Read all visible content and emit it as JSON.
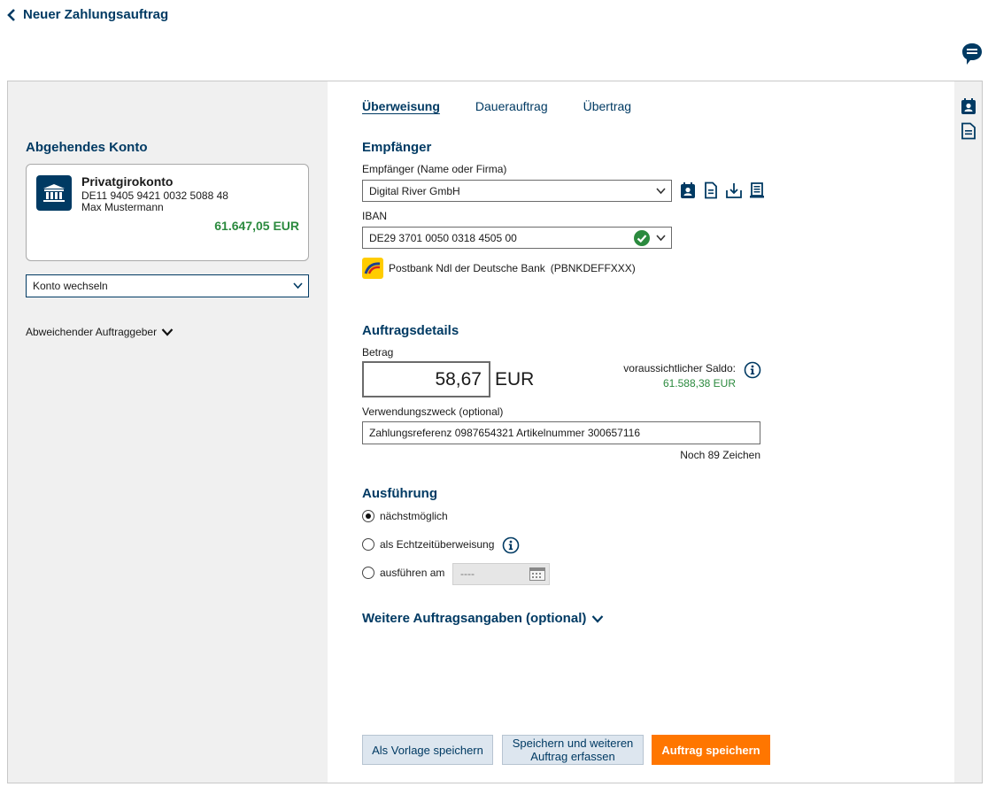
{
  "header": {
    "back_label": "Neuer Zahlungsauftrag"
  },
  "left": {
    "section_title": "Abgehendes Konto",
    "account": {
      "name": "Privatgirokonto",
      "iban": "DE11 9405 9421 0032 5088 48",
      "holder": "Max Mustermann",
      "balance": "61.647,05 EUR"
    },
    "switch_account_label": "Konto wechseln",
    "other_sender_label": "Abweichender Auftraggeber"
  },
  "tabs": [
    {
      "label": "Überweisung",
      "active": true
    },
    {
      "label": "Dauerauftrag",
      "active": false
    },
    {
      "label": "Übertrag",
      "active": false
    }
  ],
  "recipient": {
    "section_title": "Empfänger",
    "name_label": "Empfänger (Name oder Firma)",
    "name_value": "Digital River GmbH",
    "iban_label": "IBAN",
    "iban_value": "DE29 3701 0050 0318 4505 00",
    "bank_name": "Postbank Ndl der Deutsche Bank",
    "bic": "(PBNKDEFFXXX)"
  },
  "details": {
    "section_title": "Auftragsdetails",
    "amount_label": "Betrag",
    "amount_value": "58,67",
    "currency": "EUR",
    "saldo_label": "voraussichtlicher Saldo:",
    "saldo_value": "61.588,38 EUR",
    "purpose_label": "Verwendungszweck (optional)",
    "purpose_value": "Zahlungsreferenz 0987654321 Artikelnummer 300657116",
    "char_count": "Noch 89 Zeichen"
  },
  "execution": {
    "section_title": "Ausführung",
    "options": [
      {
        "label": "nächstmöglich",
        "checked": true
      },
      {
        "label": "als Echtzeitüberweisung",
        "checked": false
      },
      {
        "label": "ausführen am",
        "checked": false
      }
    ],
    "date_placeholder": "----"
  },
  "more": {
    "label": "Weitere Auftragsangaben (optional)"
  },
  "buttons": {
    "template": "Als Vorlage speichern",
    "save_more_line1": "Speichern und weiteren",
    "save_more_line2": "Auftrag erfassen",
    "save": "Auftrag speichern"
  },
  "colors": {
    "brand": "#003a63",
    "accent": "#ff7600",
    "positive": "#2b8a3e"
  }
}
